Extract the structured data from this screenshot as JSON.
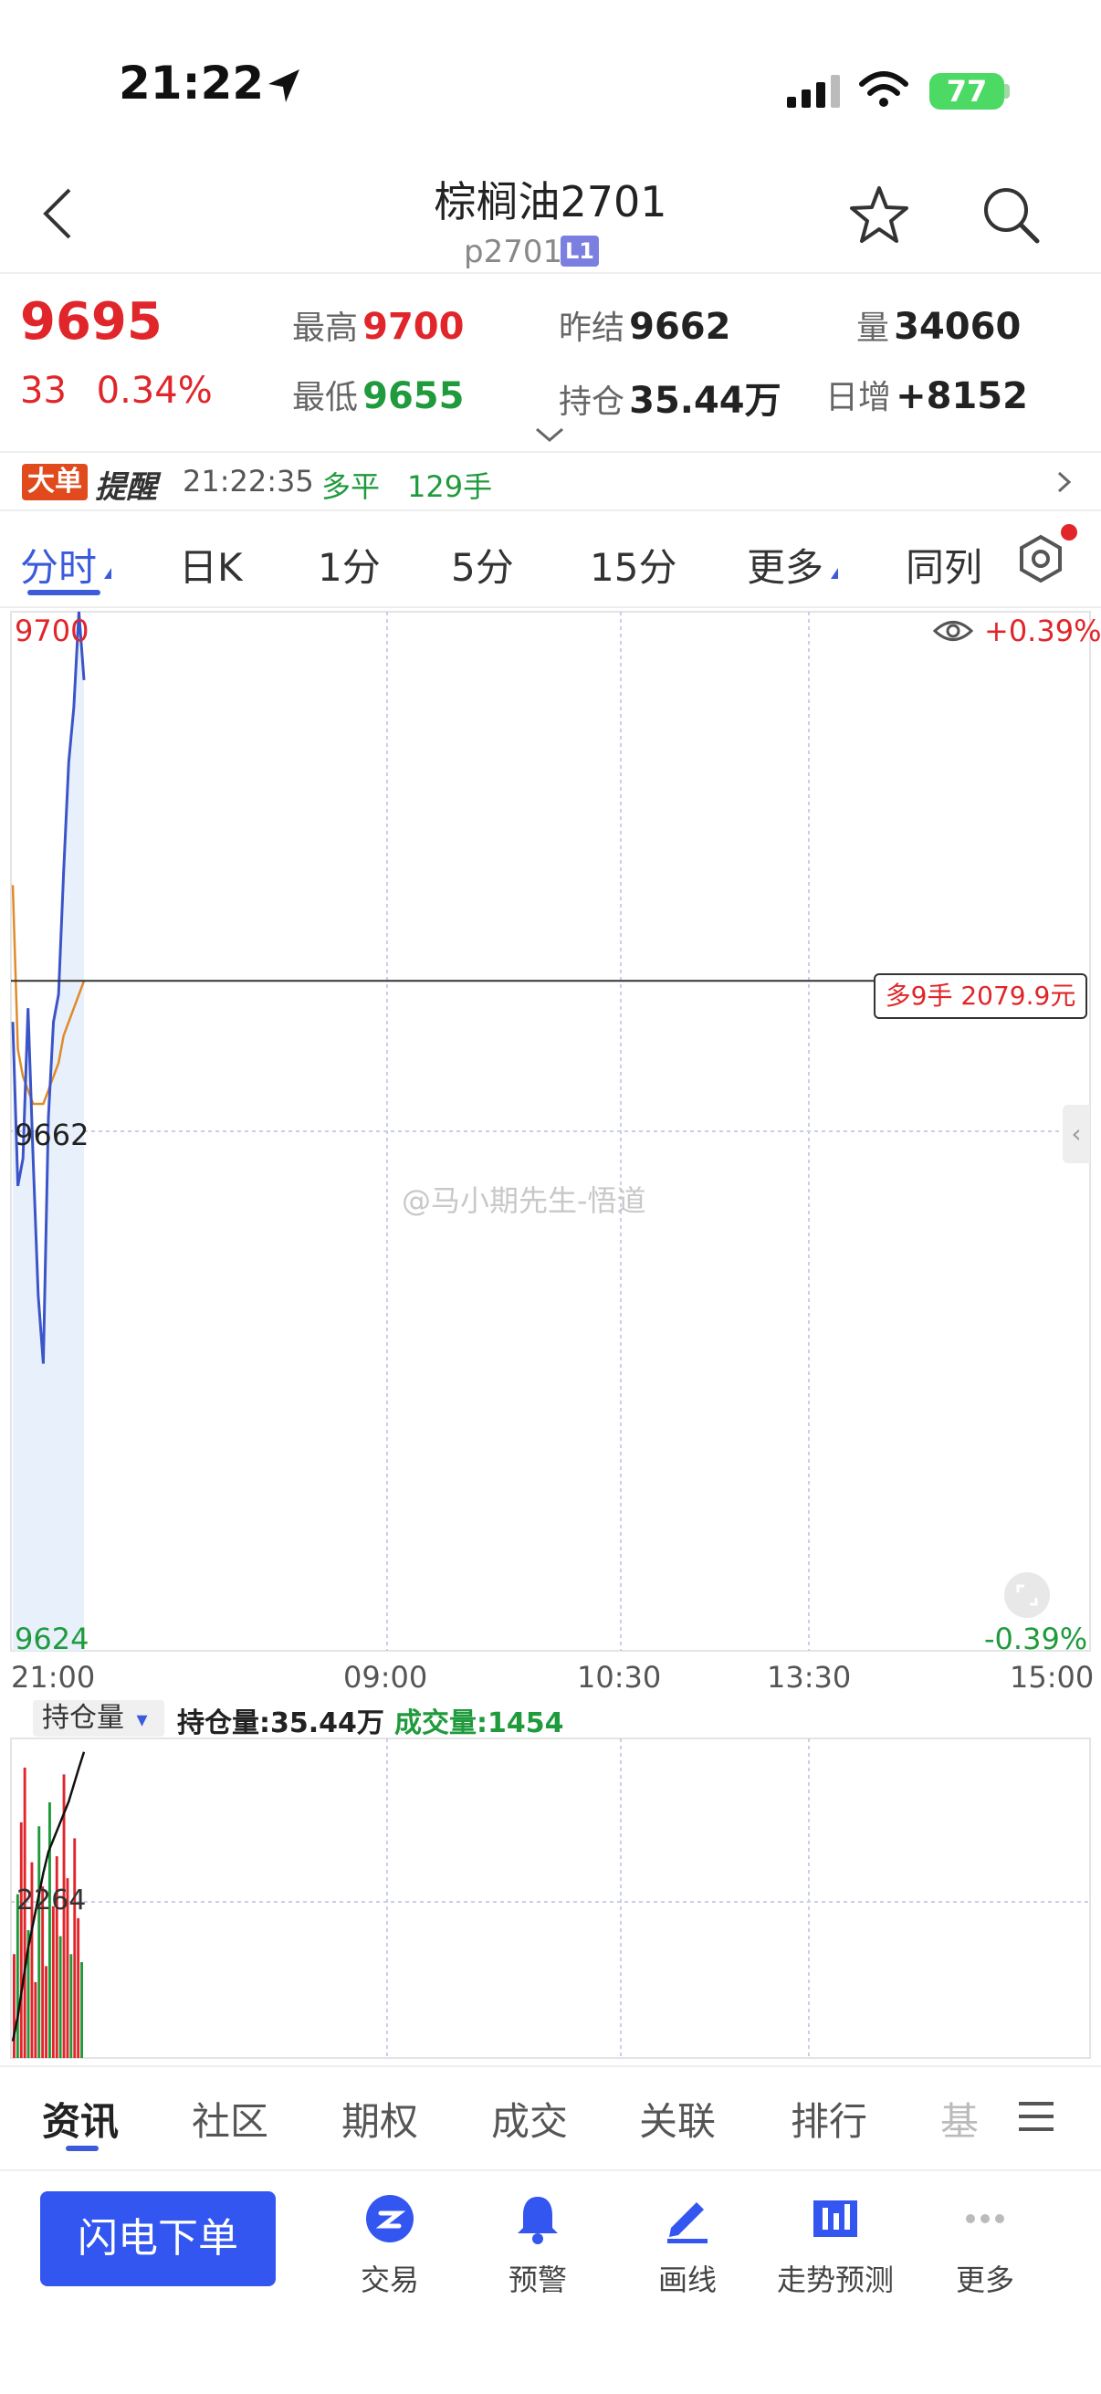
{
  "status_bar": {
    "time": "21:22",
    "battery": "77"
  },
  "header": {
    "title": "棕榈油2701",
    "code": "p2701",
    "level_badge": "L1"
  },
  "quote": {
    "price": "9695",
    "change": "33",
    "change_pct": "0.34%",
    "high_label": "最高",
    "high": "9700",
    "low_label": "最低",
    "low": "9655",
    "prev_settle_label": "昨结",
    "prev_settle": "9662",
    "open_interest_label": "持仓",
    "open_interest": "35.44万",
    "volume_label": "量",
    "volume": "34060",
    "daily_inc_label": "日增",
    "daily_inc": "+8152"
  },
  "alert": {
    "badge": "大单",
    "word": "提醒",
    "time": "21:22:35",
    "side": "多平",
    "qty": "129手"
  },
  "tabs": [
    "分时",
    "日K",
    "1分",
    "5分",
    "15分",
    "更多",
    "同列"
  ],
  "chart": {
    "pct_top": "+0.39%",
    "pct_bottom": "-0.39%",
    "order_badge": "多9手 2079.9元",
    "watermark": "@马小期先生-悟道"
  },
  "volume_panel": {
    "selector": "持仓量",
    "oi_text": "持仓量:35.44万",
    "vol_text": "成交量:1454",
    "mid_label": "2264"
  },
  "bottom_tabs": [
    "资讯",
    "社区",
    "期权",
    "成交",
    "关联",
    "排行",
    "基"
  ],
  "action_bar": {
    "primary": "闪电下单",
    "items": [
      "交易",
      "预警",
      "画线",
      "走势预测",
      "更多"
    ]
  },
  "colors": {
    "up": "#e0262a",
    "down": "#1f9a3c",
    "accent": "#3b5bdb",
    "price_line": "#3b55c8",
    "avg_line": "#e08a2a"
  },
  "chart_data": {
    "type": "line",
    "ylim": [
      9624,
      9700
    ],
    "y_ticks": [
      "9700",
      "9662",
      "9624"
    ],
    "x_ticks": [
      "21:00",
      "09:00",
      "10:30",
      "13:30",
      "15:00"
    ],
    "prev_settle": 9662,
    "series": [
      {
        "values": [
          9670,
          9658,
          9660,
          9671,
          9660,
          9650,
          9645,
          9663,
          9670,
          9672,
          9681,
          9689,
          9693,
          9700,
          9695
        ]
      },
      {
        "values": [
          9680,
          9668,
          9666,
          9665,
          9664,
          9664,
          9664,
          9665,
          9666,
          9667,
          9669,
          9670,
          9671,
          9672,
          9673
        ]
      }
    ],
    "volume_bars": [
      520,
      820,
      1180,
      1454,
      640,
      980,
      380,
      1160,
      860,
      460,
      1280,
      760,
      1010,
      610,
      1420,
      900,
      520,
      1100,
      700,
      480
    ],
    "oi_line": [
      320000,
      323000,
      327000,
      331000,
      334000,
      337000,
      340000,
      342500,
      344000,
      345500,
      347000,
      348500,
      350500,
      352500,
      354400
    ]
  }
}
